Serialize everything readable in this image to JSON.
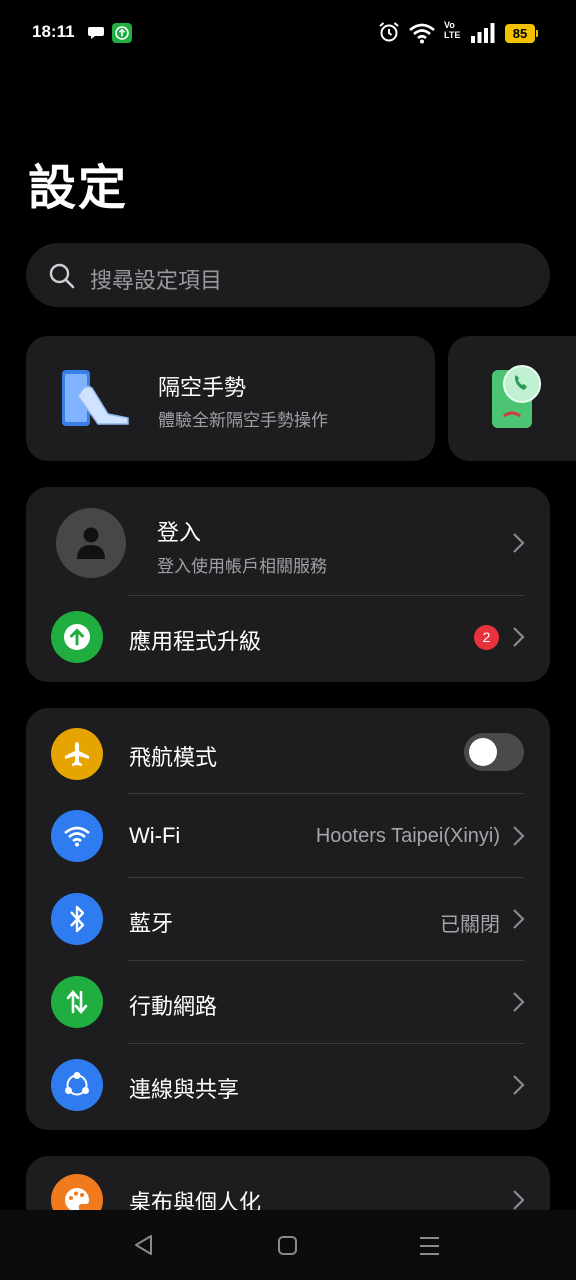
{
  "status_bar": {
    "time": "18:11",
    "battery": "85",
    "volte_top": "Vo",
    "volte_bottom": "LTE"
  },
  "page": {
    "title": "設定"
  },
  "search": {
    "placeholder": "搜尋設定項目"
  },
  "feature_card": {
    "title": "隔空手勢",
    "subtitle": "體驗全新隔空手勢操作"
  },
  "account": {
    "title": "登入",
    "subtitle": "登入使用帳戶相關服務"
  },
  "app_update": {
    "label": "應用程式升級",
    "badge": "2"
  },
  "connectivity": {
    "airplane": {
      "label": "飛航模式",
      "enabled": false
    },
    "wifi": {
      "label": "Wi-Fi",
      "value": "Hooters Taipei(Xinyi)"
    },
    "bluetooth": {
      "label": "藍牙",
      "value": "已關閉"
    },
    "mobile": {
      "label": "行動網路"
    },
    "sharing": {
      "label": "連線與共享"
    }
  },
  "personalization": {
    "label": "桌布與個人化"
  },
  "colors": {
    "airplane_icon": "#e6a400",
    "wifi_icon": "#2f7bf0",
    "bluetooth_icon": "#2f7bf0",
    "mobile_icon": "#1fae3f",
    "sharing_icon": "#2f7bf0",
    "update_icon": "#1fae3f",
    "personalization_icon": "#f07a1e",
    "badge": "#e8333f"
  }
}
